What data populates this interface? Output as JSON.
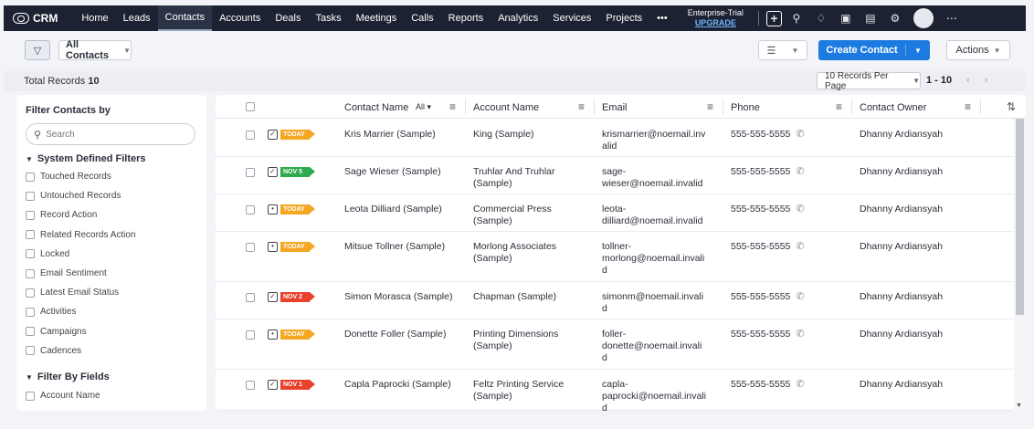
{
  "app": {
    "name": "CRM"
  },
  "nav": [
    "Home",
    "Leads",
    "Contacts",
    "Accounts",
    "Deals",
    "Tasks",
    "Meetings",
    "Calls",
    "Reports",
    "Analytics",
    "Services",
    "Projects",
    "•••"
  ],
  "nav_active": "Contacts",
  "trial": {
    "line1": "Enterprise-Trial",
    "upgrade": "UPGRADE"
  },
  "toolbar": {
    "view_label": "All Contacts",
    "create_label": "Create Contact",
    "actions_label": "Actions"
  },
  "records": {
    "total_label": "Total Records",
    "total_count": "10",
    "per_page": "10 Records Per Page",
    "range": "1 - 10"
  },
  "sidebar": {
    "title": "Filter Contacts by",
    "search_placeholder": "Search",
    "system_title": "System Defined Filters",
    "system_items": [
      "Touched Records",
      "Untouched Records",
      "Record Action",
      "Related Records Action",
      "Locked",
      "Email Sentiment",
      "Latest Email Status",
      "Activities",
      "Campaigns",
      "Cadences"
    ],
    "fields_title": "Filter By Fields",
    "field_items": [
      "Account Name"
    ]
  },
  "table": {
    "headers": {
      "name": "Contact Name",
      "all": "All",
      "account": "Account Name",
      "email": "Email",
      "phone": "Phone",
      "owner": "Contact Owner"
    },
    "rows": [
      {
        "badge": "TODAY",
        "badge_color": "#f5a623",
        "task": "check",
        "name": "Kris Marrier (Sample)",
        "account": [
          "King (Sample)"
        ],
        "email": [
          "krismarrier@noemail.inv",
          "alid"
        ],
        "phone": "555-555-5555",
        "owner": "Dhanny Ardiansyah"
      },
      {
        "badge": "NOV 5",
        "badge_color": "#2eaa4f",
        "task": "check",
        "name": "Sage Wieser (Sample)",
        "account": [
          "Truhlar And Truhlar",
          "(Sample)"
        ],
        "email": [
          "sage-",
          "wieser@noemail.invalid"
        ],
        "phone": "555-555-5555",
        "owner": "Dhanny Ardiansyah"
      },
      {
        "badge": "TODAY",
        "badge_color": "#f5a623",
        "task": "calendar",
        "name": "Leota Dilliard (Sample)",
        "account": [
          "Commercial Press (Sample)"
        ],
        "email": [
          "leota-",
          "dilliard@noemail.invalid"
        ],
        "phone": "555-555-5555",
        "owner": "Dhanny Ardiansyah"
      },
      {
        "badge": "TODAY",
        "badge_color": "#f5a623",
        "task": "calendar",
        "name": "Mitsue Tollner (Sample)",
        "account": [
          "Morlong Associates",
          "(Sample)"
        ],
        "email": [
          "tollner-",
          "morlong@noemail.invali",
          "d"
        ],
        "phone": "555-555-5555",
        "owner": "Dhanny Ardiansyah"
      },
      {
        "badge": "NOV 2",
        "badge_color": "#e8412c",
        "task": "check",
        "name": "Simon Morasca (Sample)",
        "account": [
          "Chapman (Sample)"
        ],
        "email": [
          "simonm@noemail.invali",
          "d"
        ],
        "phone": "555-555-5555",
        "owner": "Dhanny Ardiansyah"
      },
      {
        "badge": "TODAY",
        "badge_color": "#f5a623",
        "task": "calendar",
        "name": "Donette Foller (Sample)",
        "account": [
          "Printing Dimensions",
          "(Sample)"
        ],
        "email": [
          "foller-",
          "donette@noemail.invali",
          "d"
        ],
        "phone": "555-555-5555",
        "owner": "Dhanny Ardiansyah"
      },
      {
        "badge": "NOV 1",
        "badge_color": "#e8412c",
        "task": "check",
        "name": "Capla Paprocki (Sample)",
        "account": [
          "Feltz Printing Service",
          "(Sample)"
        ],
        "email": [
          "capla-",
          "paprocki@noemail.invali",
          "d"
        ],
        "phone": "555-555-5555",
        "owner": "Dhanny Ardiansyah"
      }
    ]
  }
}
